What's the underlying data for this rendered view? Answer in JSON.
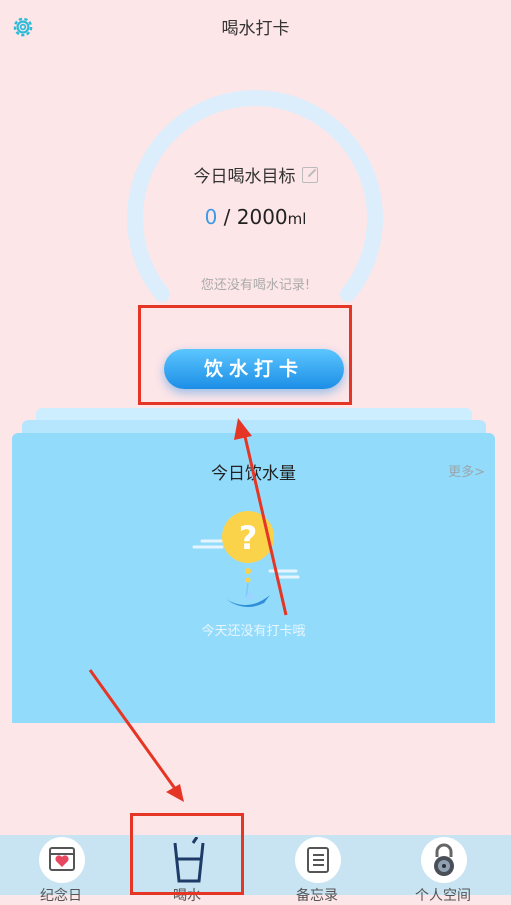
{
  "header": {
    "title": "喝水打卡",
    "settings_icon": "gear-icon"
  },
  "goal": {
    "label": "今日喝水目标",
    "edit_icon": "edit-icon",
    "current": "0",
    "separator": " / ",
    "target": "2000",
    "unit": "ml",
    "no_record": "您还没有喝水记录!",
    "progress_fraction": 0
  },
  "checkin": {
    "label": "饮水打卡"
  },
  "today": {
    "title": "今日饮水量",
    "more": "更多>",
    "empty_icon": "question-balloon-icon",
    "empty_text": "今天还没有打卡哦"
  },
  "tabs": [
    {
      "label": "纪念日",
      "icon": "calendar-heart-icon"
    },
    {
      "label": "喝水",
      "icon": "cup-icon"
    },
    {
      "label": "备忘录",
      "icon": "memo-list-icon"
    },
    {
      "label": "个人空间",
      "icon": "lock-icon"
    }
  ],
  "colors": {
    "background": "#fde6e8",
    "accent": "#3d9be6",
    "card": "#93dbfb",
    "annotation": "#e53525"
  }
}
